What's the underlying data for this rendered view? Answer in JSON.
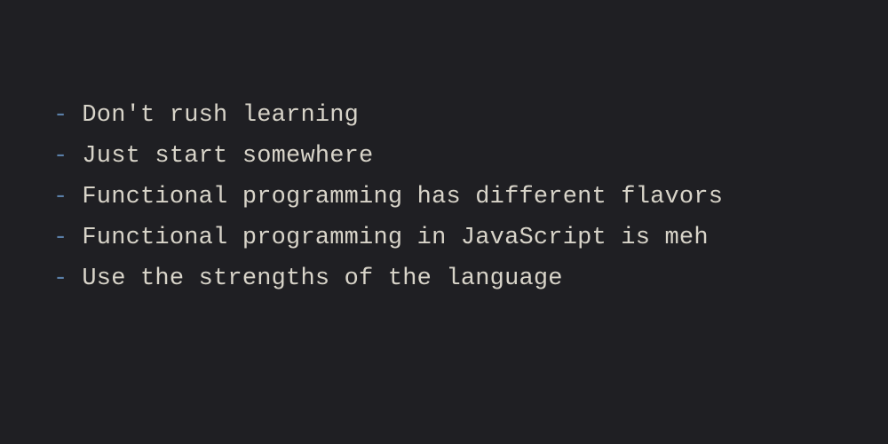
{
  "bullet": "-",
  "items": [
    "Don't rush learning",
    "Just start somewhere",
    "Functional programming has different flavors",
    "Functional programming in JavaScript is meh",
    "Use the strengths of the language"
  ]
}
